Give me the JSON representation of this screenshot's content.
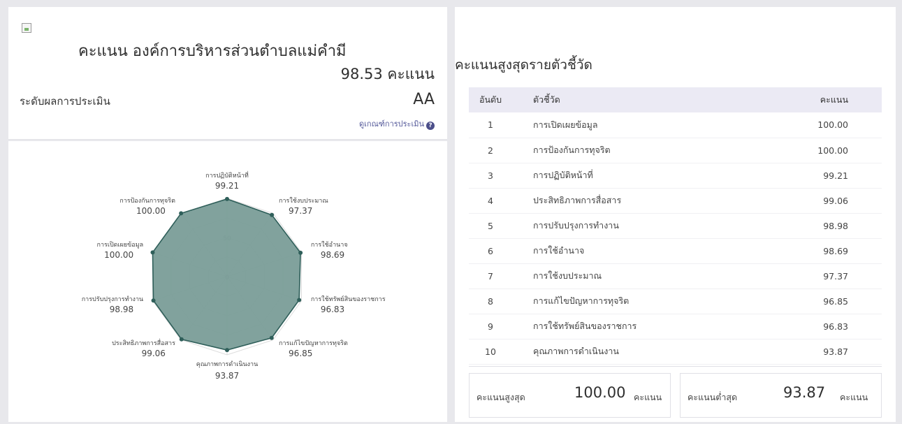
{
  "summary": {
    "title": "คะแนน องค์การบริหารส่วนตำบลแม่คำมี",
    "score": "98.53",
    "score_unit": "คะแนน",
    "level_label": "ระดับผลการประเมิน",
    "level_value": "AA",
    "criteria_link": "ดูเกณฑ์การประเมิน",
    "help_icon": "?"
  },
  "chart_data": {
    "type": "radar",
    "axes": [
      "การปฏิบัติหน้าที่",
      "การใช้งบประมาณ",
      "การใช้อำนาจ",
      "การใช้ทรัพย์สินของราชการ",
      "การแก้ไขปัญหาการทุจริต",
      "คุณภาพการดำเนินงาน",
      "ประสิทธิภาพการสื่อสาร",
      "การปรับปรุงการทำงาน",
      "การเปิดเผยข้อมูล",
      "การป้องกันการทุจริต"
    ],
    "values": [
      99.21,
      97.37,
      98.69,
      96.83,
      96.85,
      93.87,
      99.06,
      98.98,
      100.0,
      100.0
    ],
    "value_labels": [
      "99.21",
      "97.37",
      "98.69",
      "96.83",
      "96.85",
      "93.87",
      "99.06",
      "98.98",
      "100.00",
      "100.00"
    ],
    "range": [
      0,
      100
    ],
    "tick_labels": [
      "0",
      "50"
    ],
    "fill_color": "#7a9d98",
    "line_color": "#2f5f5a",
    "grid": true
  },
  "ranking": {
    "title": "คะแนนสูงสุดรายตัวชี้วัด",
    "columns": [
      "อันดับ",
      "ตัวชี้วัด",
      "คะแนน"
    ],
    "rows": [
      {
        "rank": "1",
        "name": "การเปิดเผยข้อมูล",
        "score": "100.00"
      },
      {
        "rank": "2",
        "name": "การป้องกันการทุจริต",
        "score": "100.00"
      },
      {
        "rank": "3",
        "name": "การปฏิบัติหน้าที่",
        "score": "99.21"
      },
      {
        "rank": "4",
        "name": "ประสิทธิภาพการสื่อสาร",
        "score": "99.06"
      },
      {
        "rank": "5",
        "name": "การปรับปรุงการทำงาน",
        "score": "98.98"
      },
      {
        "rank": "6",
        "name": "การใช้อำนาจ",
        "score": "98.69"
      },
      {
        "rank": "7",
        "name": "การใช้งบประมาณ",
        "score": "97.37"
      },
      {
        "rank": "8",
        "name": "การแก้ไขปัญหาการทุจริต",
        "score": "96.85"
      },
      {
        "rank": "9",
        "name": "การใช้ทรัพย์สินของราชการ",
        "score": "96.83"
      },
      {
        "rank": "10",
        "name": "คุณภาพการดำเนินงาน",
        "score": "93.87"
      }
    ]
  },
  "totals": {
    "max_label": "คะแนนสูงสุด",
    "max_value": "100.00",
    "min_label": "คะแนนต่ำสุด",
    "min_value": "93.87",
    "unit": "คะแนน"
  }
}
